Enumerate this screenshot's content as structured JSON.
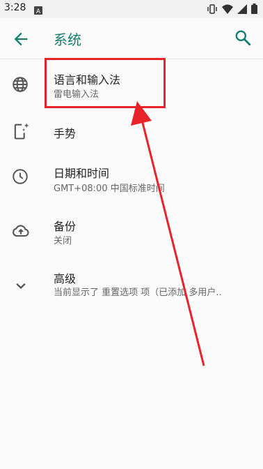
{
  "status_bar": {
    "time": "3:28",
    "notification_icon": "a-box-icon",
    "right_icons": [
      "vibrate-icon",
      "wifi-icon",
      "cellular-icon",
      "battery-icon"
    ]
  },
  "app_bar": {
    "title": "系统",
    "back_icon": "arrow-back-icon",
    "search_icon": "search-icon"
  },
  "items": [
    {
      "icon": "globe-icon",
      "title": "语言和输入法",
      "subtitle": "雷电输入法"
    },
    {
      "icon": "phone-gesture-icon",
      "title": "手势",
      "subtitle": ""
    },
    {
      "icon": "clock-icon",
      "title": "日期和时间",
      "subtitle": "GMT+08:00 中国标准时间"
    },
    {
      "icon": "cloud-backup-icon",
      "title": "备份",
      "subtitle": "关闭"
    },
    {
      "icon": "chevron-down-icon",
      "title": "高级",
      "subtitle": "当前显示了 重置选项 项（已添加 多用户.."
    }
  ],
  "colors": {
    "accent": "#137d6f",
    "annotation_red": "#e8232a"
  }
}
